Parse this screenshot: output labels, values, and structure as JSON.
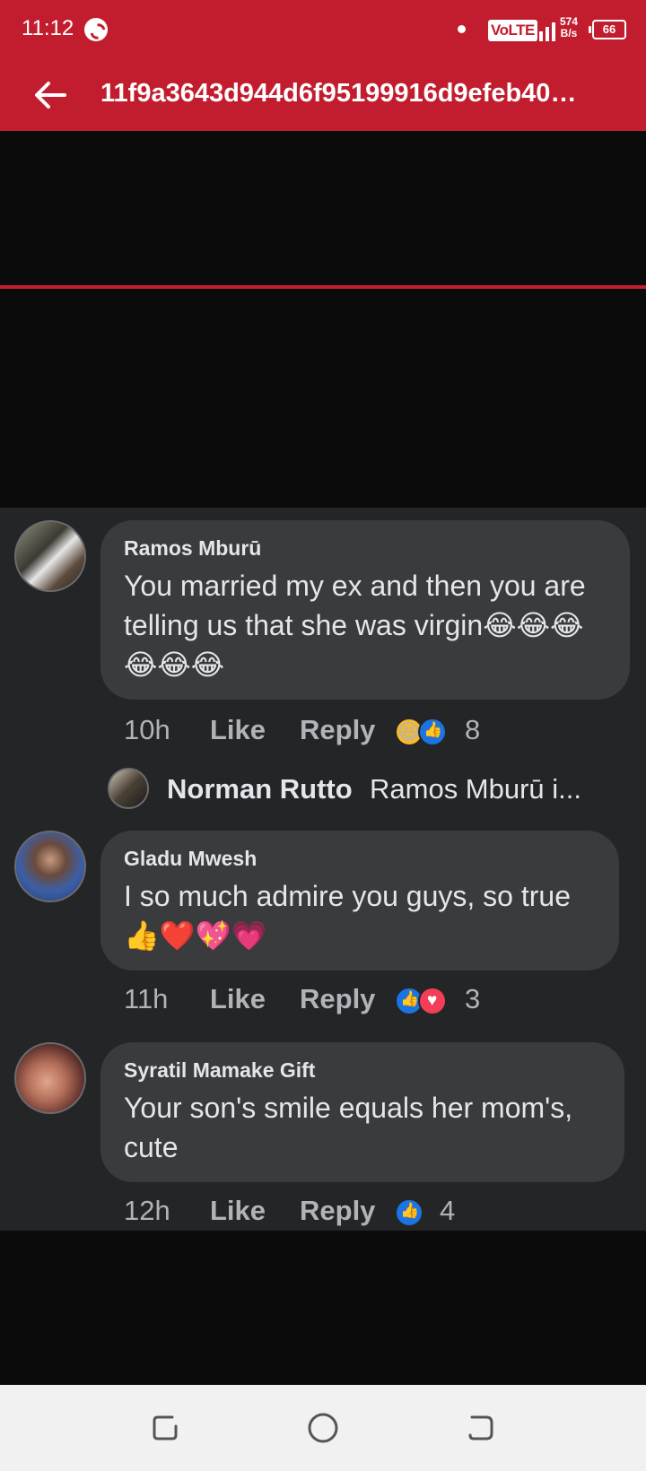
{
  "status_bar": {
    "time": "11:12",
    "network_label": "VoLTE",
    "speed_value": "574",
    "speed_unit": "B/s",
    "battery_level": "66",
    "icons": [
      "shazam-icon",
      "notification-dot-icon",
      "signal-icon",
      "battery-icon"
    ]
  },
  "header": {
    "back_icon": "arrow-left-icon",
    "title": "11f9a3643d944d6f95199916d9efeb40…"
  },
  "colors": {
    "appbar": "#c21d2f",
    "comments_bg": "#242527",
    "bubble_bg": "#3a3b3d",
    "primary_text": "#e4e6eb",
    "secondary_text": "#b0b3b8",
    "like_blue": "#1b74e4",
    "love_red": "#f33e58"
  },
  "comments": [
    {
      "author": "Ramos Mburū",
      "text": "You married my ex and then you are telling us that she was virgin😂😂😂😂😂😂",
      "age": "10h",
      "like_label": "Like",
      "reply_label": "Reply",
      "reactions": [
        "haha",
        "like"
      ],
      "reaction_count": "8"
    },
    {
      "author": "Gladu Mwesh",
      "text": "I so much admire you guys, so true 👍❤️💖💗",
      "age": "11h",
      "like_label": "Like",
      "reply_label": "Reply",
      "reactions": [
        "like",
        "love"
      ],
      "reaction_count": "3"
    },
    {
      "author": "Syratil Mamake Gift",
      "text": "Your son's smile equals her mom's, cute",
      "age": "12h",
      "like_label": "Like",
      "reply_label": "Reply",
      "reactions": [
        "like"
      ],
      "reaction_count": "4"
    }
  ],
  "reply_preview": {
    "author": "Norman Rutto",
    "text": "Ramos Mburū i..."
  },
  "navbar": {
    "icons": [
      "recents-icon",
      "home-icon",
      "back-nav-icon"
    ]
  }
}
